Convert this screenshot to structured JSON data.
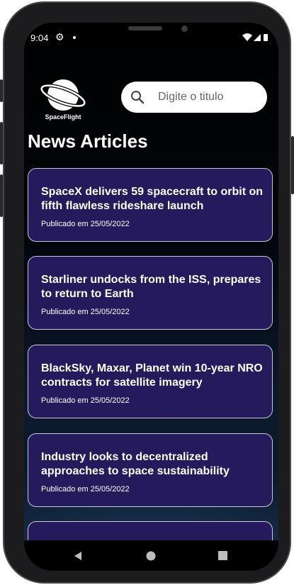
{
  "status_bar": {
    "time": "9:04"
  },
  "header": {
    "logo_text": "SpaceFlight",
    "search_placeholder": "Digite o titulo"
  },
  "page_title": "News Articles",
  "articles": [
    {
      "title": "SpaceX delivers 59 spacecraft to orbit on fifth flawless rideshare launch",
      "date": "Publicado em 25/05/2022"
    },
    {
      "title": "Starliner undocks from the ISS, prepares to return to Earth",
      "date": "Publicado em 25/05/2022"
    },
    {
      "title": "BlackSky, Maxar, Planet win 10-year NRO contracts for satellite imagery",
      "date": "Publicado em 25/05/2022"
    },
    {
      "title": "Industry looks to decentralized approaches to space sustainability",
      "date": "Publicado em 25/05/2022"
    }
  ],
  "colors": {
    "card_bg": "#251a5c",
    "card_border": "#c8c8d8",
    "text": "#ffffff"
  },
  "nav_icons": [
    "back-icon",
    "home-icon",
    "recents-icon"
  ]
}
